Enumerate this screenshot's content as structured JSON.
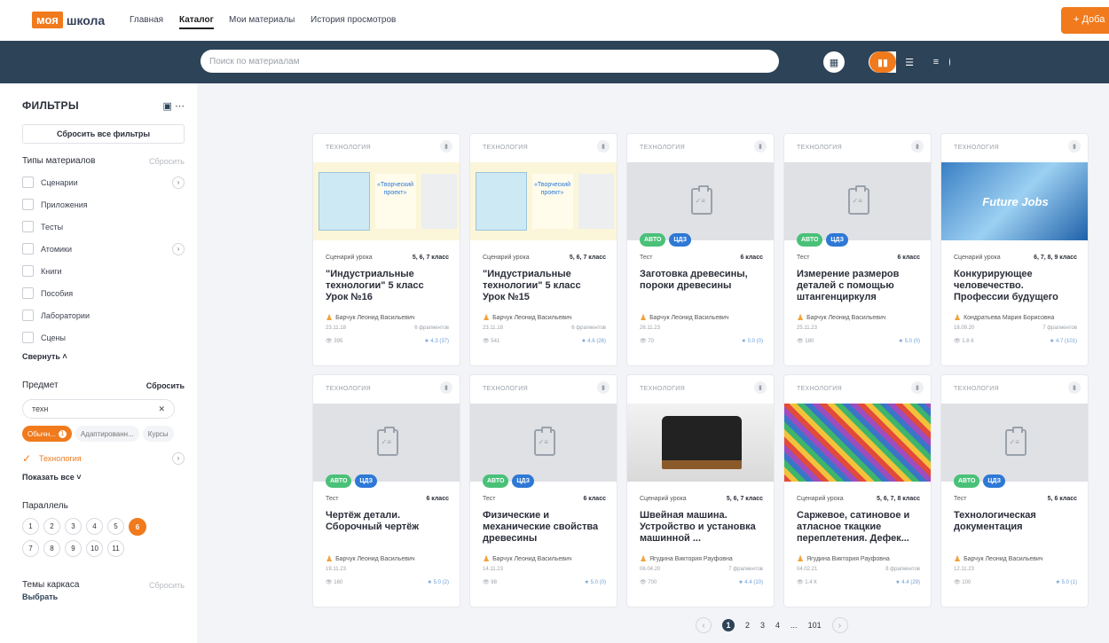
{
  "brand": {
    "part1": "моя",
    "part2": "школа"
  },
  "nav": {
    "items": [
      "Главная",
      "Каталог",
      "Мои материалы",
      "История просмотров"
    ],
    "add_label": "+ Доба"
  },
  "search": {
    "placeholder": "Поиск по материалам"
  },
  "sidebar": {
    "title": "ФИЛЬТРЫ",
    "reset_all": "Сбросить все фильтры",
    "types_title": "Типы материалов",
    "types_reset": "Сбросить",
    "types": [
      "Сценарии",
      "Приложения",
      "Тесты",
      "Атомики",
      "Книги",
      "Пособия",
      "Лаборатории",
      "Сцены"
    ],
    "collapse": "Свернуть",
    "subject_title": "Предмет",
    "subject_reset": "Сбросить",
    "subject_search": "техн",
    "chips": [
      "Обычн...",
      "Адаптированн...",
      "Курсы"
    ],
    "chip_badge": "1",
    "subject_checked": "Технология",
    "show_all": "Показать все",
    "parallel_title": "Параллель",
    "grades_row1": [
      "1",
      "2",
      "3",
      "4",
      "5",
      "6"
    ],
    "grades_row2": [
      "7",
      "8",
      "9",
      "10",
      "11"
    ],
    "active_grade": "6",
    "themes_title": "Темы каркаса",
    "themes_reset": "Сбросить",
    "themes_select": "Выбрать"
  },
  "cards": [
    {
      "subject": "ТЕХНОЛОГИЯ",
      "type": "Сценарий урока",
      "grade": "5, 6, 7 класс",
      "title": "\"Индустриальные технологии\" 5 класс Урок №16",
      "author": "Барчук Леонид Васильевич",
      "date": "23.11.18",
      "fragments": "6 фрагментов",
      "views": "395",
      "rating": "4.3 (37)",
      "image": "book",
      "book_title": "«Творческий проект»",
      "tags": []
    },
    {
      "subject": "ТЕХНОЛОГИЯ",
      "type": "Сценарий урока",
      "grade": "5, 6, 7 класс",
      "title": "\"Индустриальные технологии\" 5 класс Урок №15",
      "author": "Барчук Леонид Васильевич",
      "date": "23.11.18",
      "fragments": "6 фрагментов",
      "views": "541",
      "rating": "4.6 (26)",
      "image": "book",
      "book_title": "«Творческий проект»",
      "tags": []
    },
    {
      "subject": "ТЕХНОЛОГИЯ",
      "type": "Тест",
      "grade": "6 класс",
      "title": "Заготовка древесины, пороки древесины",
      "author": "Барчук Леонид Васильевич",
      "date": "26.11.23",
      "fragments": "",
      "views": "70",
      "rating": "0.0 (0)",
      "image": "placeholder",
      "tags": [
        "АВТО",
        "ЦДЗ"
      ]
    },
    {
      "subject": "ТЕХНОЛОГИЯ",
      "type": "Тест",
      "grade": "6 класс",
      "title": "Измерение размеров деталей с помощью штангенциркуля",
      "author": "Барчук Леонид Васильевич",
      "date": "25.11.23",
      "fragments": "",
      "views": "180",
      "rating": "5.0 (0)",
      "image": "placeholder",
      "tags": [
        "АВТО",
        "ЦДЗ"
      ]
    },
    {
      "subject": "ТЕХНОЛОГИЯ",
      "type": "Сценарий урока",
      "grade": "6, 7, 8, 9 класс",
      "title": "Конкурирующее человечество. Профессии будущего",
      "author": "Кондратьева Мария Борисовна",
      "date": "18.09.20",
      "fragments": "7 фрагментов",
      "views": "1.8 К",
      "rating": "4.7 (101)",
      "image": "future",
      "image_text": "Future Jobs",
      "tags": []
    },
    {
      "subject": "ТЕХНОЛОГИЯ",
      "type": "Тест",
      "grade": "6 класс",
      "title": "Чертёж детали. Сборочный чертёж",
      "author": "Барчук Леонид Васильевич",
      "date": "19.11.23",
      "fragments": "",
      "views": "160",
      "rating": "5.0 (2)",
      "image": "placeholder",
      "tags": [
        "АВТО",
        "ЦДЗ"
      ]
    },
    {
      "subject": "ТЕХНОЛОГИЯ",
      "type": "Тест",
      "grade": "6 класс",
      "title": "Физические и механические свойства древесины",
      "author": "Барчук Леонид Васильевич",
      "date": "14.11.23",
      "fragments": "",
      "views": "98",
      "rating": "5.0 (0)",
      "image": "placeholder",
      "tags": [
        "АВТО",
        "ЦДЗ"
      ]
    },
    {
      "subject": "ТЕХНОЛОГИЯ",
      "type": "Сценарий урока",
      "grade": "5, 6, 7 класс",
      "title": "Швейная машина. Устройство и установка машинной ...",
      "author": "Ягудина Виктория Рауфовна",
      "date": "06.04.20",
      "fragments": "7 фрагментов",
      "views": "700",
      "rating": "4.4 (10)",
      "image": "sew",
      "tags": []
    },
    {
      "subject": "ТЕХНОЛОГИЯ",
      "type": "Сценарий урока",
      "grade": "5, 6, 7, 8 класс",
      "title": "Саржевое, сатиновое и атласное ткацкие переплетения. Дефек...",
      "author": "Ягудина Виктория Рауфовна",
      "date": "04.02.21",
      "fragments": "8 фрагментов",
      "views": "1.4 К",
      "rating": "4.4 (29)",
      "image": "textile",
      "tags": []
    },
    {
      "subject": "ТЕХНОЛОГИЯ",
      "type": "Тест",
      "grade": "5, 6 класс",
      "title": "Технологическая документация",
      "author": "Барчук Леонид Васильевич",
      "date": "12.11.23",
      "fragments": "",
      "views": "100",
      "rating": "5.0 (1)",
      "image": "placeholder",
      "tags": [
        "АВТО",
        "ЦДЗ"
      ]
    }
  ],
  "pagination": {
    "pages": [
      "1",
      "2",
      "3",
      "4",
      "...",
      "101"
    ],
    "current": "1"
  }
}
